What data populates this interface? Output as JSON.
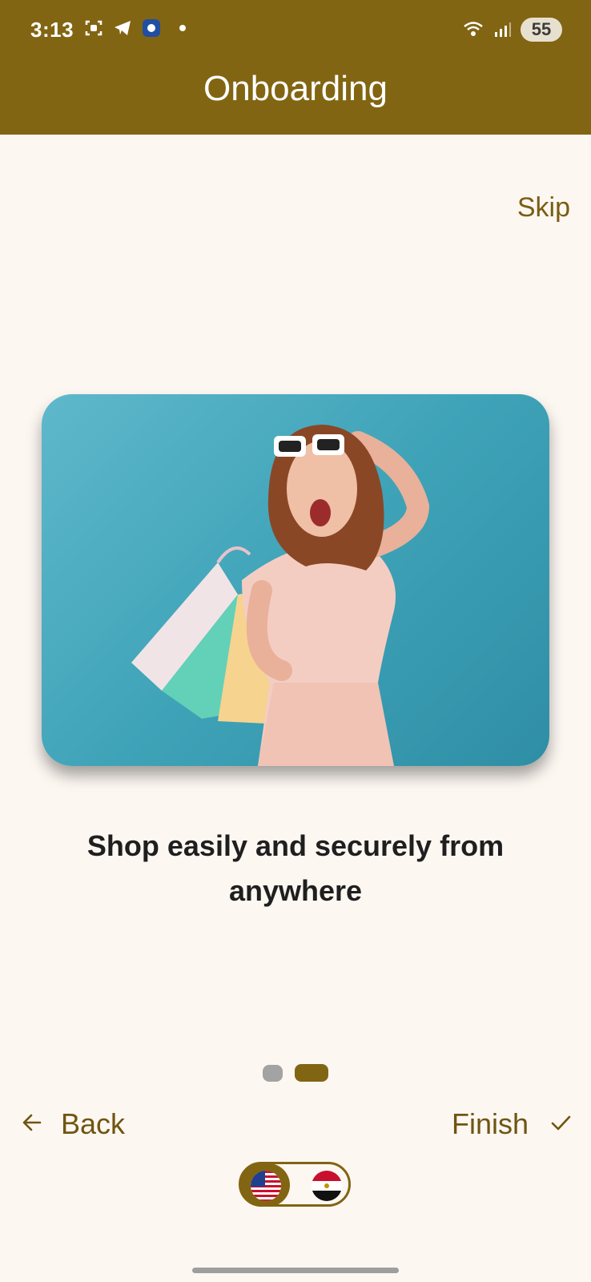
{
  "status": {
    "time": "3:13",
    "icons_left": [
      "screenshot-icon",
      "telegram-icon",
      "app-badge-icon"
    ],
    "icons_right": [
      "wifi-icon",
      "signal-icon"
    ],
    "battery": "55"
  },
  "app_bar": {
    "title": "Onboarding"
  },
  "onboarding": {
    "skip_label": "Skip",
    "caption": "Shop easily and securely from anywhere",
    "page_index": 2,
    "page_count": 2,
    "back_label": "Back",
    "finish_label": "Finish"
  },
  "language_switch": {
    "options": [
      "us-flag",
      "egypt-flag"
    ],
    "selected": "us-flag"
  },
  "colors": {
    "brand": "#826512",
    "background": "#fdf7f2",
    "indicator_inactive": "#a3a3a3"
  }
}
